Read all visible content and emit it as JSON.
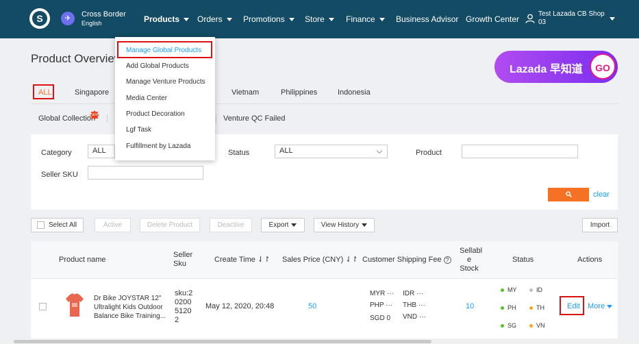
{
  "topbar": {
    "region": "Cross Border",
    "language": "English",
    "nav": [
      {
        "label": "Products",
        "dropdown": true
      },
      {
        "label": "Orders",
        "dropdown": true
      },
      {
        "label": "Promotions",
        "dropdown": true
      },
      {
        "label": "Store",
        "dropdown": true
      },
      {
        "label": "Finance",
        "dropdown": true
      },
      {
        "label": "Business Advisor",
        "dropdown": false
      },
      {
        "label": "Growth Center",
        "dropdown": false
      }
    ],
    "user_line1": "Test Lazada CB Shop",
    "user_line2": "03"
  },
  "products_menu": {
    "items": [
      "Manage Global Products",
      "Add Global Products",
      "Manage Venture Products",
      "Media Center",
      "Product Decoration",
      "Lgf Task",
      "Fulfillment by Lazada"
    ]
  },
  "page": {
    "title": "Product Overview"
  },
  "promo": {
    "text": "Lazada 早知道",
    "go": "GO"
  },
  "country_tabs": [
    "ALL",
    "Singapore",
    "Vietnam",
    "Philippines",
    "Indonesia"
  ],
  "status_tabs": {
    "global": "Global Collection",
    "badge": "NEW",
    "venture": "Venture QC Failed"
  },
  "filters": {
    "category_label": "Category",
    "category_value": "ALL",
    "status_label": "Status",
    "status_value": "ALL",
    "product_label": "Product",
    "product_value": "",
    "seller_sku_label": "Seller SKU",
    "seller_sku_value": "",
    "clear": "clear"
  },
  "toolbar": {
    "select_all": "Select All",
    "active": "Active",
    "delete": "Delete Product",
    "deactive": "Deactive",
    "export": "Export",
    "view_history": "View History",
    "import": "Import"
  },
  "table": {
    "headers": {
      "product_name": "Product name",
      "seller_sku_1": "Seller",
      "seller_sku_2": "Sku",
      "create_time": "Create Time",
      "sales_price": "Sales Price (CNY)",
      "shipping_fee": "Customer Shipping Fee",
      "sellable_1": "Sellabl",
      "sellable_2": "e",
      "sellable_3": "Stock",
      "status": "Status",
      "actions": "Actions"
    },
    "rows": [
      {
        "name_1": "Dr Bike JOYSTAR 12\"",
        "name_2": "Ultralight Kids Outdoor",
        "name_3": "Balance Bike Training...",
        "sku_1": "sku:2",
        "sku_2": "0200",
        "sku_3": "5120",
        "sku_4": "2",
        "create_time": "May 12, 2020, 20:48",
        "price": "50",
        "fees": {
          "myr": "MYR ···",
          "idr": "IDR ···",
          "php": "PHP ···",
          "thb": "THB ···",
          "sgd": "SGD 0",
          "vnd": "VND ···"
        },
        "stock": "10",
        "status": {
          "my": "MY",
          "id": "ID",
          "ph": "PH",
          "th": "TH",
          "sg": "SG",
          "vn": "VN"
        },
        "edit": "Edit",
        "more": "More"
      }
    ]
  },
  "colors": {
    "topbar": "#124b63",
    "accent": "#f57224",
    "link": "#1a9cff",
    "highlight_box": "#e01010",
    "status_green": "#52c41a",
    "status_gray": "#bfbfbf",
    "status_orange": "#f5a623"
  }
}
